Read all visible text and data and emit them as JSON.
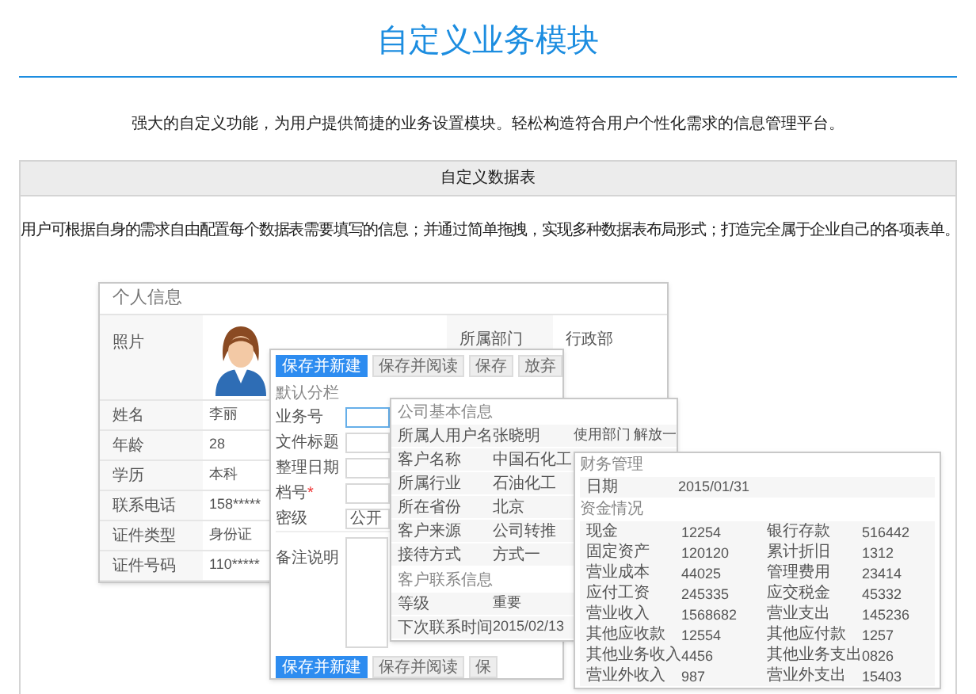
{
  "page": {
    "title": "自定义业务模块",
    "subtitle": "强大的自定义功能，为用户提供简捷的业务设置模块。轻松构造符合用户个性化需求的信息管理平台。"
  },
  "section": {
    "heading": "自定义数据表",
    "description": "用户可根据自身的需求自由配置每个数据表需要填写的信息；并通过简单拖拽，实现多种数据表布局形式；打造完全属于企业自己的各项表单。"
  },
  "personal_window": {
    "title": "个人信息",
    "photo_label": "照片",
    "department_label": "所属部门",
    "department_value": "行政部",
    "rows": [
      {
        "label": "姓名",
        "value": "李丽"
      },
      {
        "label": "年龄",
        "value": "28"
      },
      {
        "label": "学历",
        "value": "本科"
      },
      {
        "label": "联系电话",
        "value": "158*****"
      },
      {
        "label": "证件类型",
        "value": "身份证"
      },
      {
        "label": "证件号码",
        "value": "110*****"
      }
    ]
  },
  "form_window": {
    "buttons": [
      {
        "label": "保存并新建",
        "primary": true
      },
      {
        "label": "保存并阅读",
        "primary": false
      },
      {
        "label": "保存",
        "primary": false
      },
      {
        "label": "放弃",
        "primary": false
      }
    ],
    "section": "默认分栏",
    "fields": [
      {
        "label": "业务号",
        "focused": true
      },
      {
        "label": "文件标题",
        "focused": false
      },
      {
        "label": "整理日期",
        "focused": false
      },
      {
        "label": "档号",
        "required_mark": "*",
        "focused": false
      },
      {
        "label": "密级",
        "value": "公开",
        "focused": false
      }
    ],
    "remark_label": "备注说明",
    "bottom_buttons": [
      {
        "label": "保存并新建",
        "primary": true
      },
      {
        "label": "保存并阅读",
        "primary": false
      },
      {
        "label": "保",
        "primary": false
      }
    ]
  },
  "company_window": {
    "title": "公司基本信息",
    "extra_label": "使用部门",
    "extra_value": "解放一",
    "rows": [
      {
        "label": "所属人用户名",
        "value": "张晓明"
      },
      {
        "label": "客户名称",
        "value": "中国石化工"
      },
      {
        "label": "所属行业",
        "value": "石油化工"
      },
      {
        "label": "所在省份",
        "value": "北京"
      },
      {
        "label": "客户来源",
        "value": "公司转推"
      },
      {
        "label": "接待方式",
        "value": "方式一"
      }
    ],
    "contact_title": "客户联系信息",
    "contact_rows": [
      {
        "label": "等级",
        "value": "重要"
      },
      {
        "label": "下次联系时间",
        "value": "2015/02/13"
      }
    ]
  },
  "finance_window": {
    "title": "财务管理",
    "date_label": "日期",
    "date_value": "2015/01/31",
    "funds_title": "资金情况",
    "items": [
      {
        "label": "现金",
        "value": "12254"
      },
      {
        "label": "银行存款",
        "value": "516442"
      },
      {
        "label": "固定资产",
        "value": "120120"
      },
      {
        "label": "累计折旧",
        "value": "1312"
      },
      {
        "label": "营业成本",
        "value": "44025"
      },
      {
        "label": "管理费用",
        "value": "23414"
      },
      {
        "label": "应付工资",
        "value": "245335"
      },
      {
        "label": "应交税金",
        "value": "45332"
      },
      {
        "label": "营业收入",
        "value": "1568682"
      },
      {
        "label": "营业支出",
        "value": "145236"
      },
      {
        "label": "其他应收款",
        "value": "12554"
      },
      {
        "label": "其他应付款",
        "value": "1257"
      },
      {
        "label": "其他业务收入",
        "value": "4456"
      },
      {
        "label": "其他业务支出",
        "value": "0826"
      },
      {
        "label": "营业外收入",
        "value": "987"
      },
      {
        "label": "营业外支出",
        "value": "15403"
      }
    ]
  }
}
